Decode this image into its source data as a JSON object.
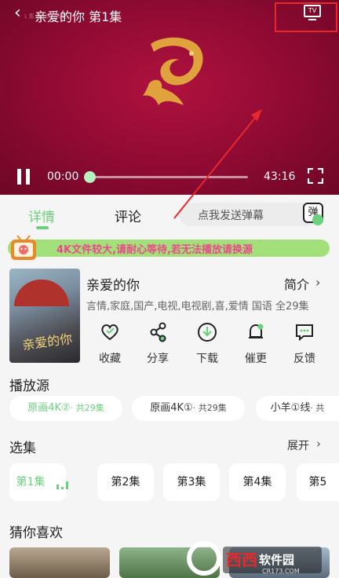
{
  "player": {
    "back_icon": "‹",
    "title": "亲爱的你 第1集",
    "tiny_text": "1 集 第1季 第1集",
    "tv_label": "TV",
    "current_time": "00:00",
    "total_time": "43:16",
    "progress": 0.0,
    "highlight_color": "#e8282a"
  },
  "tabs": {
    "items": [
      "详情",
      "评论"
    ],
    "active": "详情",
    "danmu_placeholder": "点我发送弹幕",
    "danmu_button": "弹"
  },
  "notice": {
    "text": "4K文件较大,请耐心等待,若无法播放请换源"
  },
  "detail": {
    "poster_title": "亲爱的你",
    "show_name": "亲爱的你",
    "intro_label": "简介",
    "tags": "言情,家庭,国产,电视,电视剧,喜,爱情 国语 全29集",
    "actions": [
      {
        "label": "收藏",
        "icon": "heart-icon"
      },
      {
        "label": "分享",
        "icon": "share-icon"
      },
      {
        "label": "下载",
        "icon": "download-icon"
      },
      {
        "label": "催更",
        "icon": "bell-icon"
      },
      {
        "label": "反馈",
        "icon": "feedback-icon"
      }
    ]
  },
  "sources": {
    "title": "播放源",
    "items": [
      {
        "name": "原画4K②",
        "count": "· 共29集"
      },
      {
        "name": "原画4K①",
        "count": "· 共29集"
      },
      {
        "name": "小羊①线",
        "count": "· 共"
      }
    ]
  },
  "episodes": {
    "title": "选集",
    "expand_label": "展开",
    "items": [
      "第1集",
      "第2集",
      "第3集",
      "第4集",
      "第5"
    ]
  },
  "recommend": {
    "title": "猜你喜欢"
  },
  "watermark": {
    "text": "西西软件园",
    "sub": "CR173.COM"
  },
  "accent_color": "#6cd07d"
}
